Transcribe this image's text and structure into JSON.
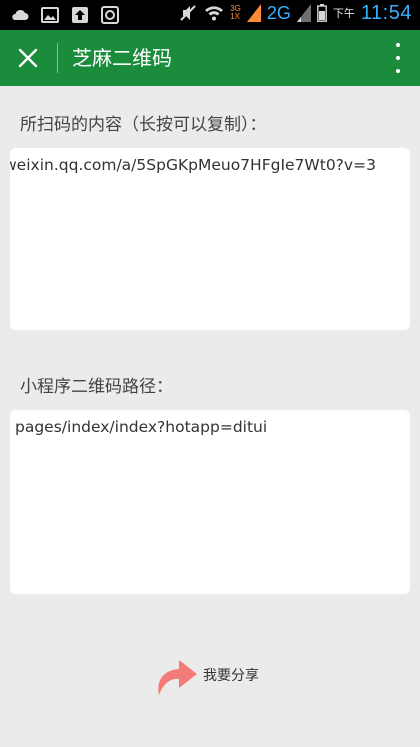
{
  "status_bar": {
    "network_badge_top": "3G",
    "network_badge_bottom": "1X",
    "network_type": "2G",
    "ampm": "下午",
    "time": "11:54"
  },
  "title_bar": {
    "title": "芝麻二维码"
  },
  "scanned": {
    "label": "所扫码的内容（长按可以复制）：",
    "value": "weixin.qq.com/a/5SpGKpMeuo7HFgIe7Wt0?v=3"
  },
  "miniprogram": {
    "label": "小程序二维码路径：",
    "value": "pages/index/index?hotapp=ditui"
  },
  "share": {
    "label": "我要分享"
  },
  "colors": {
    "title_bar": "#1a8c3c",
    "background": "#ebebeb",
    "share_icon": "#f47c78",
    "status_accent": "#36b0ff"
  }
}
